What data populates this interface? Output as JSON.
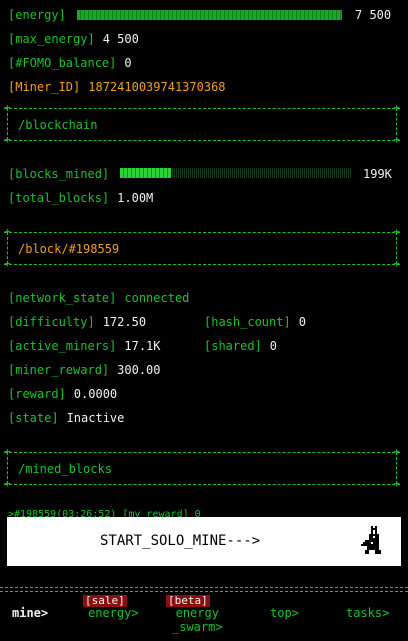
{
  "stats": {
    "energy_label": "[energy]",
    "energy_value": "7 500",
    "energy_fill": 1.0,
    "max_energy_label": "[max_energy]",
    "max_energy_value": "4 500",
    "fomo_label": "[#FOMO_balance]",
    "fomo_value": "0",
    "miner_id_label": "[Miner_ID]",
    "miner_id_value": "1872410039741370368"
  },
  "blockchain": {
    "title": "/blockchain",
    "blocks_mined_label": "[blocks_mined]",
    "blocks_mined_value": "199K",
    "blocks_mined_fill": 0.22,
    "total_blocks_label": "[total_blocks]",
    "total_blocks_value": "1.00M"
  },
  "block": {
    "title": "/block/#198559",
    "network_state_label": "[network_state]",
    "network_state_value": "connected",
    "difficulty_label": "[difficulty]",
    "difficulty_value": "172.50",
    "hash_count_label": "[hash_count]",
    "hash_count_value": "0",
    "active_miners_label": "[active_miners]",
    "active_miners_value": "17.1K",
    "shared_label": "[shared]",
    "shared_value": "0",
    "miner_reward_label": "[miner_reward]",
    "miner_reward_value": "300.00",
    "reward_label": "[reward]",
    "reward_value": "0.0000",
    "state_label": "[state]",
    "state_value": "Inactive"
  },
  "mined_blocks": {
    "title": "/mined_blocks",
    "peek_row": ">#198559(03:26:52)          [my_reward]      0"
  },
  "start_button": {
    "label": "START_SOLO_MINE--->"
  },
  "nav": {
    "mine": "mine>",
    "energy": "energy>",
    "energy_badge": "[sale]",
    "swarm_line1": "energy",
    "swarm_line2": "_swarm>",
    "swarm_badge": "[beta]",
    "top": "top>",
    "tasks": "tasks>"
  },
  "colors": {
    "green": "#19c42a",
    "orange": "#f0a020",
    "badge_red": "#8a1010"
  }
}
